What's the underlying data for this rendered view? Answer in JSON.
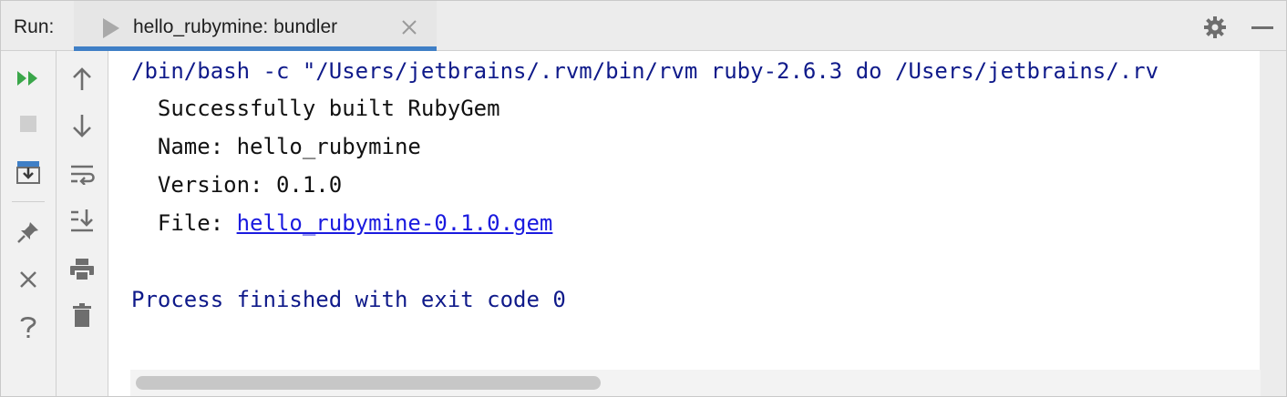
{
  "header": {
    "run_label": "Run:",
    "tab_title": "hello_rubymine: bundler"
  },
  "toolbar": {
    "left_icons": [
      "rerun-icon",
      "stop-icon",
      "restore-layout-icon",
      "pin-icon",
      "close-icon",
      "help-icon"
    ],
    "right_icons": [
      "up-arrow-icon",
      "down-arrow-icon",
      "soft-wrap-icon",
      "scroll-to-end-icon",
      "print-icon",
      "trash-icon"
    ]
  },
  "console": {
    "command": "/bin/bash -c \"/Users/jetbrains/.rvm/bin/rvm ruby-2.6.3 do /Users/jetbrains/.rv",
    "output": [
      "  Successfully built RubyGem",
      "  Name: hello_rubymine",
      "  Version: 0.1.0"
    ],
    "file_label": "  File: ",
    "file_link": "hello_rubymine-0.1.0.gem",
    "finish": "Process finished with exit code 0"
  },
  "colors": {
    "command_text": "#0f1a8a",
    "link": "#1a1adf",
    "tab_accent": "#3f7fc6",
    "rerun_green": "#3aa64a"
  }
}
